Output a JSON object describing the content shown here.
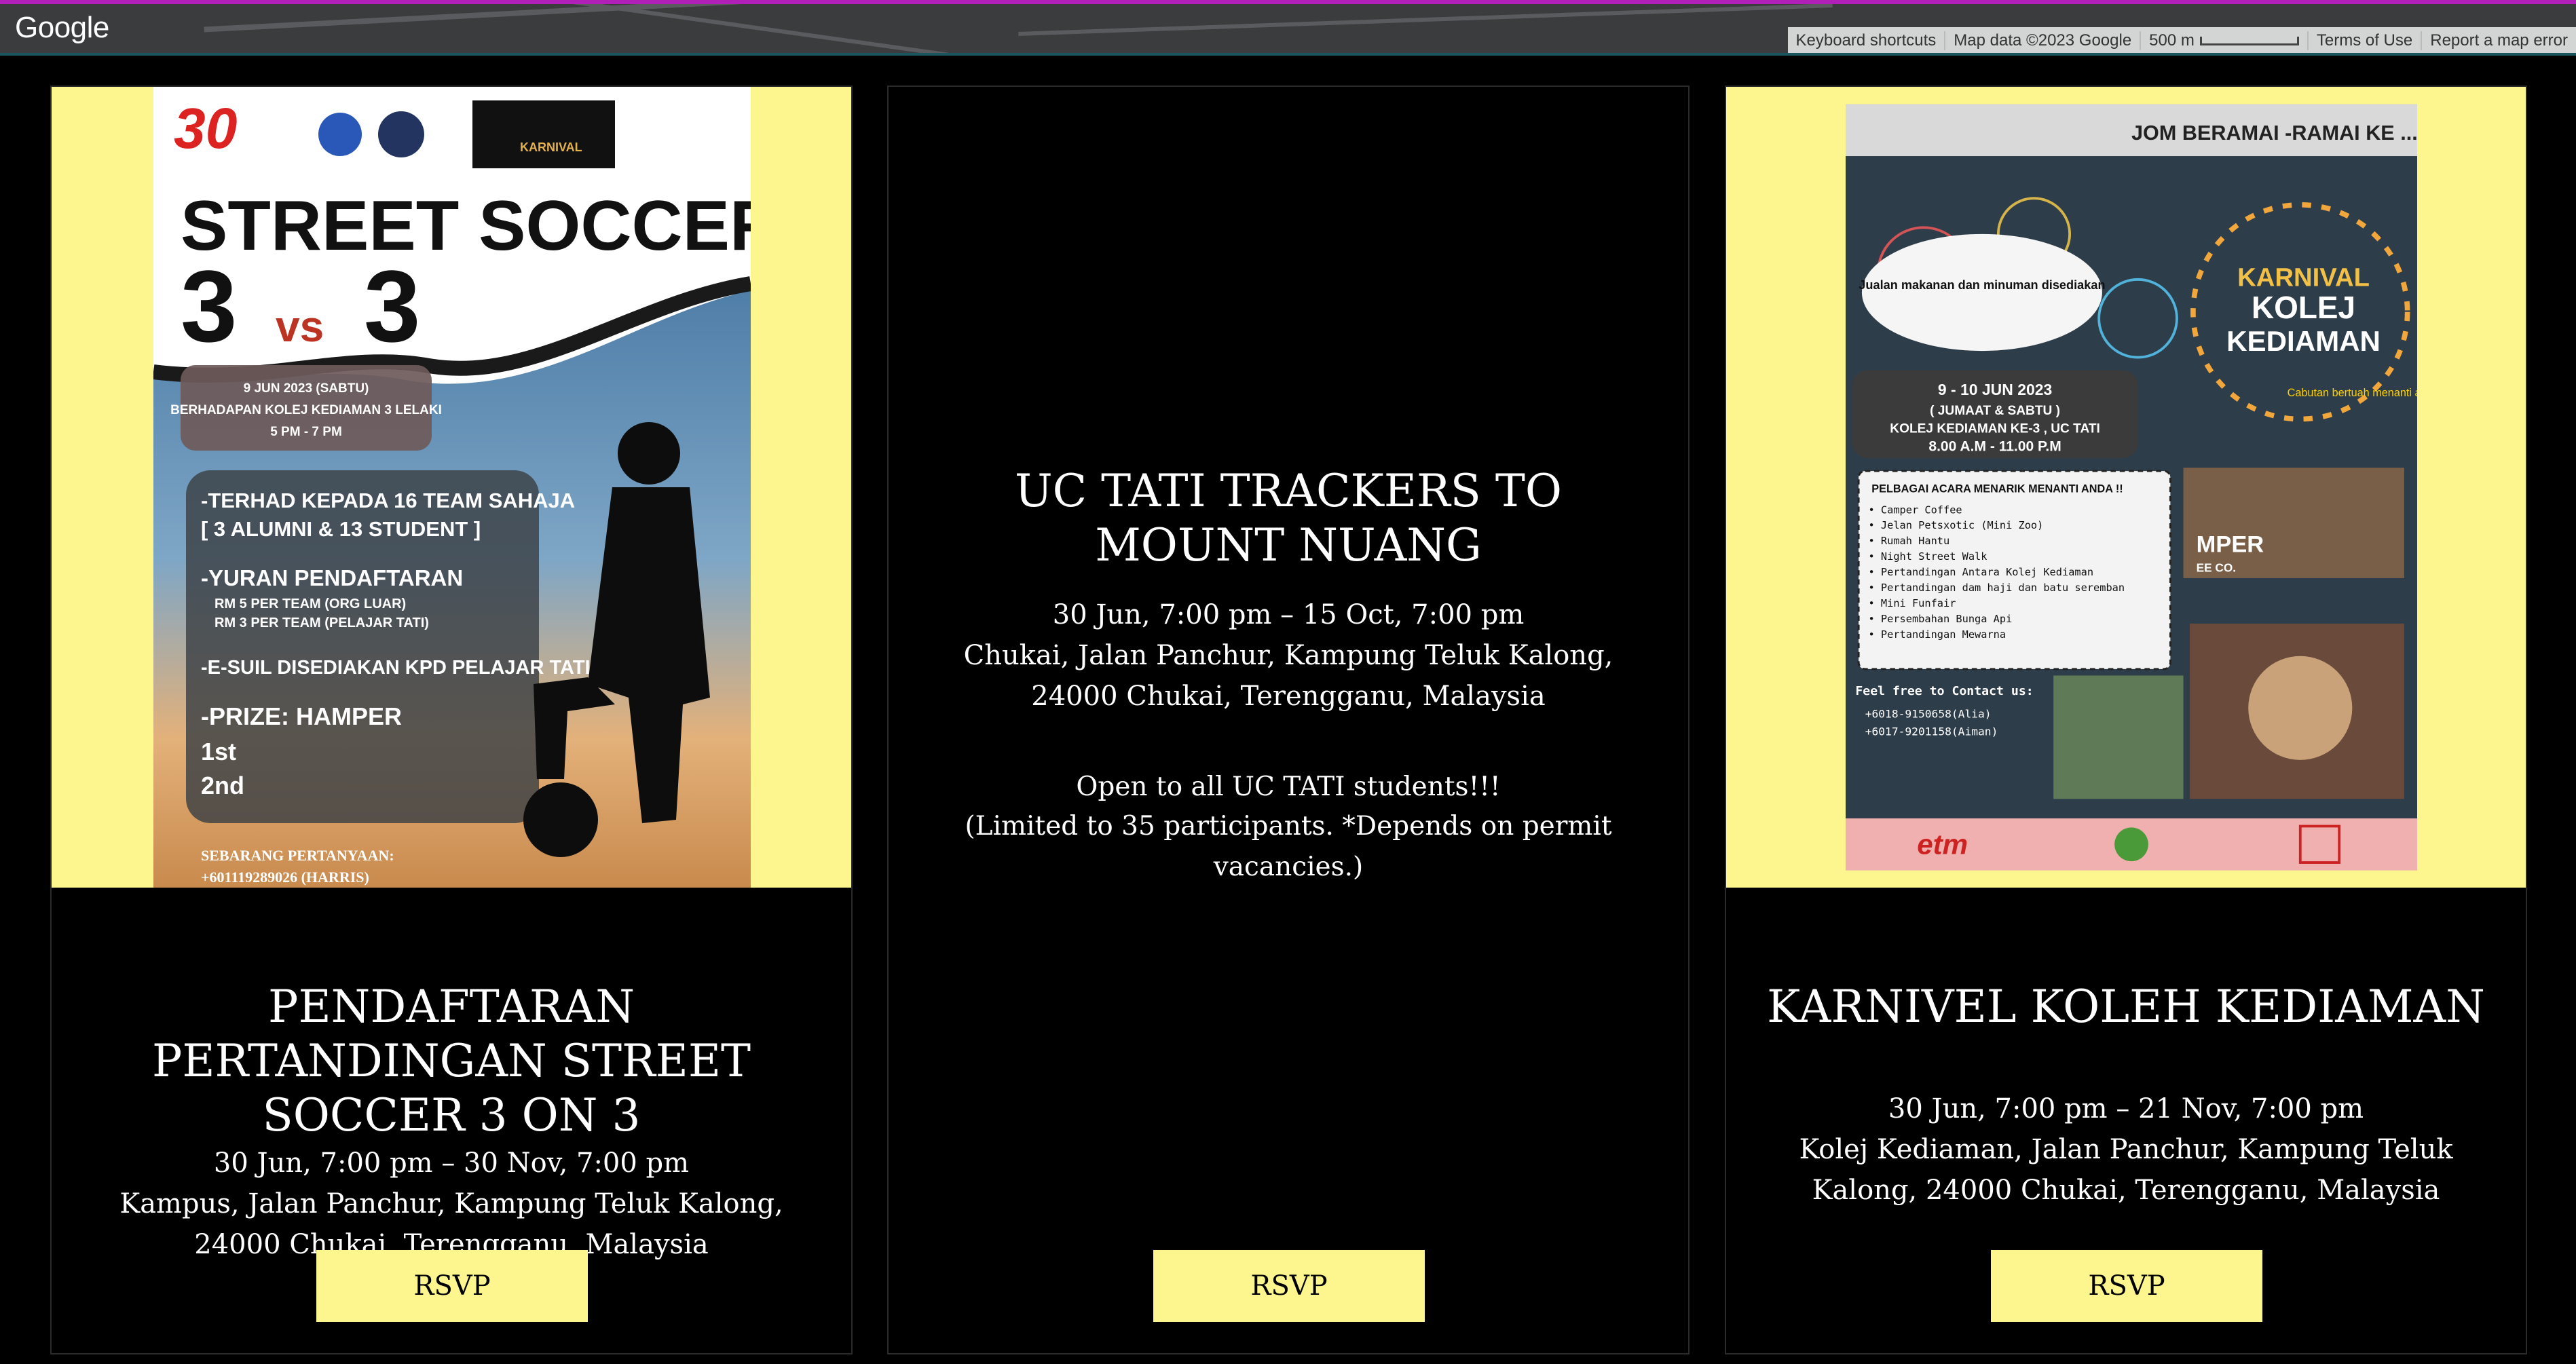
{
  "map": {
    "logo_text": "Google",
    "attribution": {
      "keyboard": "Keyboard shortcuts",
      "map_data": "Map data ©2023 Google",
      "scale": "500 m",
      "terms": "Terms of Use",
      "report": "Report a map error"
    }
  },
  "events": [
    {
      "title": "Pendaftaran Pertandingan Street Soccer 3 on 3",
      "datetime": "30 Jun, 7:00 pm – 30 Nov, 7:00 pm",
      "location": "Kampus, Jalan Panchur, Kampung Teluk Kalong, 24000 Chukai, Terengganu, Malaysia",
      "rsvp_label": "RSVP",
      "poster": {
        "headline": "STREET SOCCER",
        "subheadline_left": "3",
        "subheadline_vs": "vs",
        "subheadline_right": "3",
        "date_line1": "9 JUN 2023 (SABTU)",
        "date_line2": "BERHADAPAN KOLEJ KEDIAMAN 3 LELAKI",
        "date_line3": "5 PM - 7 PM",
        "rule1": "-TERHAD KEPADA 16 TEAM SAHAJA",
        "rule1b": "[ 3 ALUMNI & 13 STUDENT ]",
        "rule2": "-YURAN PENDAFTARAN",
        "rule2a": "RM 5 PER TEAM (ORG LUAR)",
        "rule2b": "RM 3 PER TEAM (PELAJAR TATI)",
        "rule3": "-E-SUIL DISEDIAKAN KPD PELAJAR TATI",
        "prize": "-PRIZE: HAMPER",
        "prize1": "1st",
        "prize2": "2nd",
        "contact1": "SEBARANG PERTANYAAN:",
        "contact2": "+601119289026 (HARRIS)",
        "badge_30": "30",
        "badge_karnival": "KARNIVAL"
      }
    },
    {
      "title": "UC TATI Trackers to Mount Nuang",
      "datetime": "30 Jun, 7:00 pm – 15 Oct, 7:00 pm",
      "location": "Chukai, Jalan Panchur, Kampung Teluk Kalong, 24000 Chukai, Terengganu, Malaysia",
      "description_line1": "Open to all UC TATI students!!!",
      "description_line2": "(Limited to 35 participants. *Depends on permit vacancies.)",
      "rsvp_label": "RSVP"
    },
    {
      "title": "Karnivel Koleh Kediaman",
      "datetime": "30 Jun, 7:00 pm – 21 Nov, 7:00 pm",
      "location": "Kolej Kediaman, Jalan Panchur, Kampung Teluk Kalong, 24000 Chukai, Terengganu, Malaysia",
      "rsvp_label": "RSVP",
      "poster": {
        "banner": "JOM BERAMAI -RAMAI KE ...",
        "headline1": "KARNIVAL",
        "headline2": "KOLEJ",
        "headline3": "KEDIAMAN",
        "food": "Jualan makanan dan minuman disediakan",
        "date1": "9 - 10 JUN 2023",
        "date2": "( JUMAAT & SABTU )",
        "date3": "KOLEJ KEDIAMAN KE-3 , UC TATI",
        "date4": "8.00 A.M - 11.00 P.M",
        "list_title": "PELBAGAI ACARA MENARIK MENANTI ANDA !!",
        "list": [
          "• Camper Coffee",
          "• Jelan Petsxotic (Mini Zoo)",
          "• Rumah Hantu",
          "• Night Street Walk",
          "• Pertandingan Antara Kolej Kediaman",
          "• Pertandingan dam haji dan batu seremban",
          "• Mini Funfair",
          "• Persembahan Bunga Api",
          "• Pertandingan Mewarna"
        ],
        "contact_title": "Feel free to Contact us:",
        "contact1": "+6018-9150658(Alia)",
        "contact2": "+6017-9201158(Aiman)",
        "prize_note": "Cabutan bertuah menanti anda",
        "camper": "MPER",
        "camper_sub": "EE CO.",
        "sponsor1": "etm"
      }
    }
  ]
}
